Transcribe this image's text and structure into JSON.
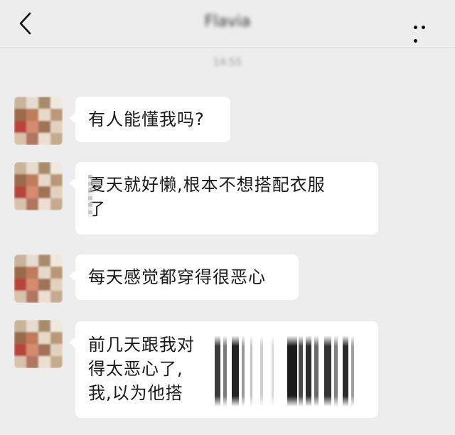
{
  "header": {
    "back_icon": "chevron-left-icon",
    "contact_name": "Flavia",
    "more_icon": "ellipsis-icon"
  },
  "timestamp": "14:55",
  "messages": [
    {
      "lines": [
        "有人能懂我吗?"
      ]
    },
    {
      "lines": [
        "夏天就好懒,根本不想搭配衣服",
        "了"
      ]
    },
    {
      "lines": [
        "每天感觉都穿得很恶心"
      ]
    },
    {
      "lines": [
        "前几天跟我对",
        "得太恶心了,",
        "我,以为他搭"
      ]
    }
  ]
}
